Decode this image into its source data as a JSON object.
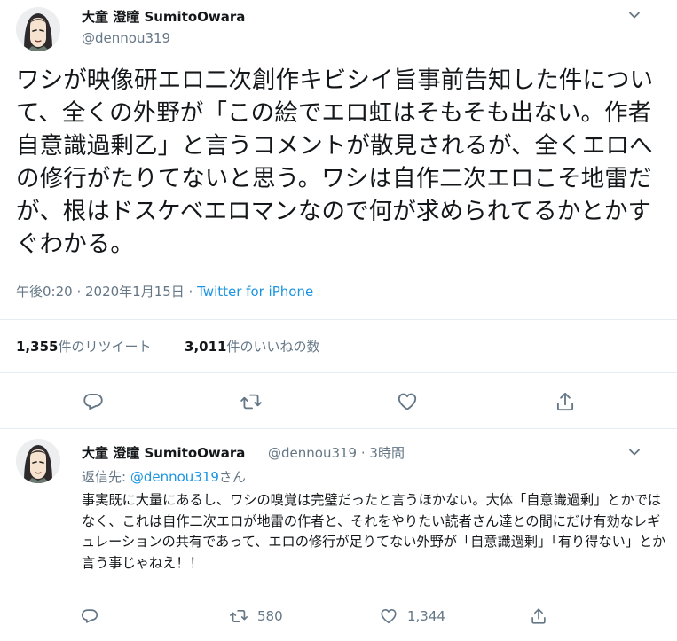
{
  "main_tweet": {
    "author_name": "大童 澄瞳 SumitoOwara",
    "author_handle": "@dennou319",
    "text": "ワシが映像研エロ二次創作キビシイ旨事前告知した件について、全くの外野が「この絵でエロ虹はそもそも出ない。作者自意識過剰乙」と言うコメントが散見されるが、全くエロへの修行がたりてないと思う。ワシは自作二次エロこそ地雷だが、根はドスケベエロマンなので何が求められてるかとかすぐわかる。",
    "timestamp": "午後0:20 · 2020年1月15日 ·",
    "source": "Twitter for iPhone",
    "retweets_count": "1,355",
    "retweets_label": "件のリツイート",
    "likes_count": "3,011",
    "likes_label": "件のいいねの数"
  },
  "reply_tweet": {
    "author_name": "大童 澄瞳 SumitoOwara",
    "author_handle": "@dennou319",
    "time_ago": "· 3時間",
    "reply_to_prefix": "返信先: ",
    "reply_to_handle": "@dennou319",
    "reply_to_suffix": "さん",
    "text": "事実既に大量にあるし、ワシの嗅覚は完璧だったと言うほかない。大体「自意識過剰」とかではなく、これは自作二次エロが地雷の作者と、それをやりたい読者さん達との間にだけ有効なレギュレーションの共有であって、エロの修行が足りてない外野が「自意識過剰」「有り得ない」とか言う事じゃねえ！！",
    "retweets_count": "580",
    "likes_count": "1,344"
  },
  "icons": [
    "chevron-down-icon",
    "reply-icon",
    "retweet-icon",
    "like-icon",
    "share-icon"
  ],
  "colors": {
    "link": "#1b95e0",
    "secondary": "#657786",
    "text": "#14171a",
    "divider": "#e6ecf0"
  }
}
